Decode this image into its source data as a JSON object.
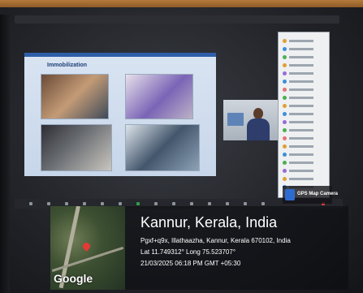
{
  "slide": {
    "title": "Immobilization"
  },
  "app_badge": {
    "name": "GPS Map Camera",
    "icon": "map-camera-icon"
  },
  "map": {
    "brand": "Google",
    "marker": "location-pin-icon"
  },
  "location": {
    "title": "Kannur, Kerala, India",
    "address": "Pgxf+q9x, Illathaazha, Kannur, Kerala 670102, India",
    "coords": "Lat 11.749312° Long 75.523707°",
    "timestamp": "21/03/2025 06:18 PM GMT +05:30"
  },
  "colors": {
    "slide_header": "#2f5ea9",
    "pin": "#e53935"
  }
}
